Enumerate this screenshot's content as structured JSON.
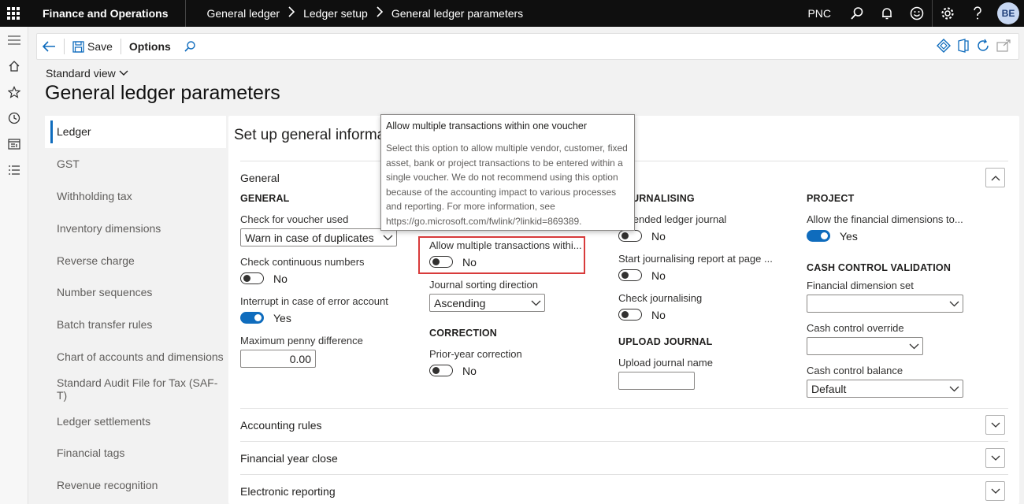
{
  "topbar": {
    "app_title": "Finance and Operations",
    "breadcrumbs": [
      "General ledger",
      "Ledger setup",
      "General ledger parameters"
    ],
    "company": "PNC",
    "avatar_initials": "BE"
  },
  "actionbar": {
    "save_label": "Save",
    "options_label": "Options"
  },
  "page": {
    "view_label": "Standard view",
    "title": "General ledger parameters"
  },
  "tabs": [
    "Ledger",
    "GST",
    "Withholding tax",
    "Inventory dimensions",
    "Reverse charge",
    "Number sequences",
    "Batch transfer rules",
    "Chart of accounts and dimensions",
    "Standard Audit File for Tax (SAF-T)",
    "Ledger settlements",
    "Financial tags",
    "Revenue recognition"
  ],
  "content": {
    "set_title": "Set up general informa",
    "sections": {
      "general": "General",
      "accounting_rules": "Accounting rules",
      "financial_year_close": "Financial year close",
      "electronic_reporting": "Electronic reporting"
    },
    "col1": {
      "group": "GENERAL",
      "voucher_label": "Check for voucher used",
      "voucher_value": "Warn in case of duplicates",
      "continuous_label": "Check continuous numbers",
      "continuous_value": "No",
      "interrupt_label": "Interrupt in case of error account",
      "interrupt_value": "Yes",
      "penny_label": "Maximum penny difference",
      "penny_value": "0.00"
    },
    "col2": {
      "allow_multi_label": "Allow multiple transactions withi...",
      "allow_multi_value": "No",
      "sort_label": "Journal sorting direction",
      "sort_value": "Ascending",
      "correction_group": "CORRECTION",
      "prior_year_label": "Prior-year correction",
      "prior_year_value": "No"
    },
    "col3": {
      "group": "JOURNALISING",
      "extended_label": "Extended ledger journal",
      "extended_value": "No",
      "start_report_label": "Start journalising report at page ...",
      "start_report_value": "No",
      "check_journalising_label": "Check journalising",
      "check_journalising_value": "No",
      "upload_group": "UPLOAD JOURNAL",
      "upload_name_label": "Upload journal name",
      "upload_name_value": ""
    },
    "col4": {
      "group": "PROJECT",
      "fin_dim_label": "Allow the financial dimensions to...",
      "fin_dim_value": "Yes",
      "cash_group": "CASH CONTROL VALIDATION",
      "dim_set_label": "Financial dimension set",
      "dim_set_value": "",
      "override_label": "Cash control override",
      "override_value": "",
      "balance_label": "Cash control balance",
      "balance_value": "Default"
    }
  },
  "tooltip": {
    "title": "Allow multiple transactions within one voucher",
    "body": "Select this option to allow multiple vendor, customer, fixed asset, bank or project transactions to be entered within a single voucher. We do not recommend using this option because of the accounting impact to various processes and reporting. For more information, see https://go.microsoft.com/fwlink/?linkid=869389."
  },
  "colors": {
    "accent": "#0f6cbd",
    "topbar": "#0f0f0f",
    "highlight": "#d83b3b"
  }
}
